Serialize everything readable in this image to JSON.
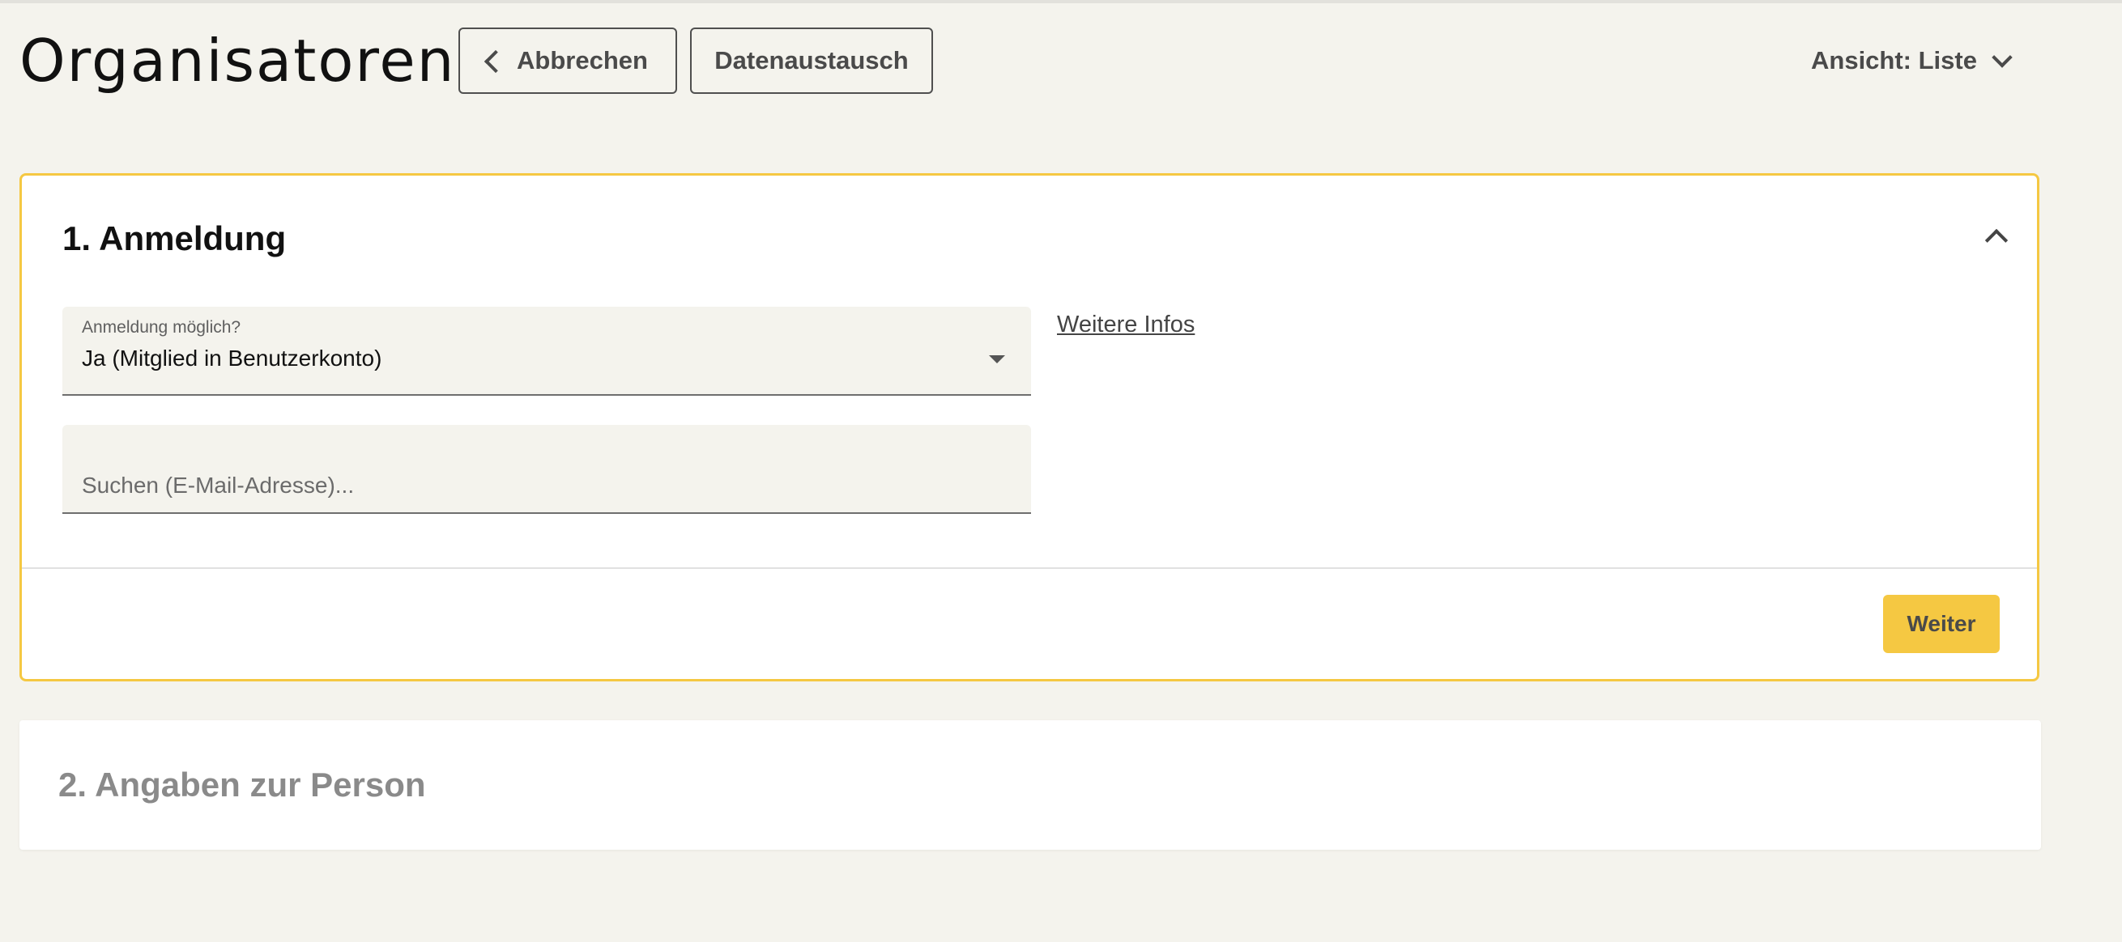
{
  "header": {
    "title": "Organisatoren",
    "cancel_label": "Abbrechen",
    "exchange_label": "Datenaustausch",
    "view_label": "Ansicht: Liste"
  },
  "step1": {
    "title": "1. Anmeldung",
    "signup_select": {
      "label": "Anmeldung möglich?",
      "value": "Ja (Mitglied in Benutzerkonto)"
    },
    "more_info_link": "Weitere Infos",
    "search": {
      "placeholder": "Suchen (E-Mail-Adresse)...",
      "value": ""
    },
    "next_label": "Weiter"
  },
  "step2": {
    "title": "2. Angaben zur Person"
  },
  "colors": {
    "background": "#f4f3ed",
    "accent": "#f5c842",
    "text": "#111111",
    "muted_text": "#8a8a8a"
  },
  "icons": {
    "cancel": "chevron-left-icon",
    "view": "chevron-down-icon",
    "collapse": "chevron-up-icon",
    "select": "caret-down-icon"
  }
}
